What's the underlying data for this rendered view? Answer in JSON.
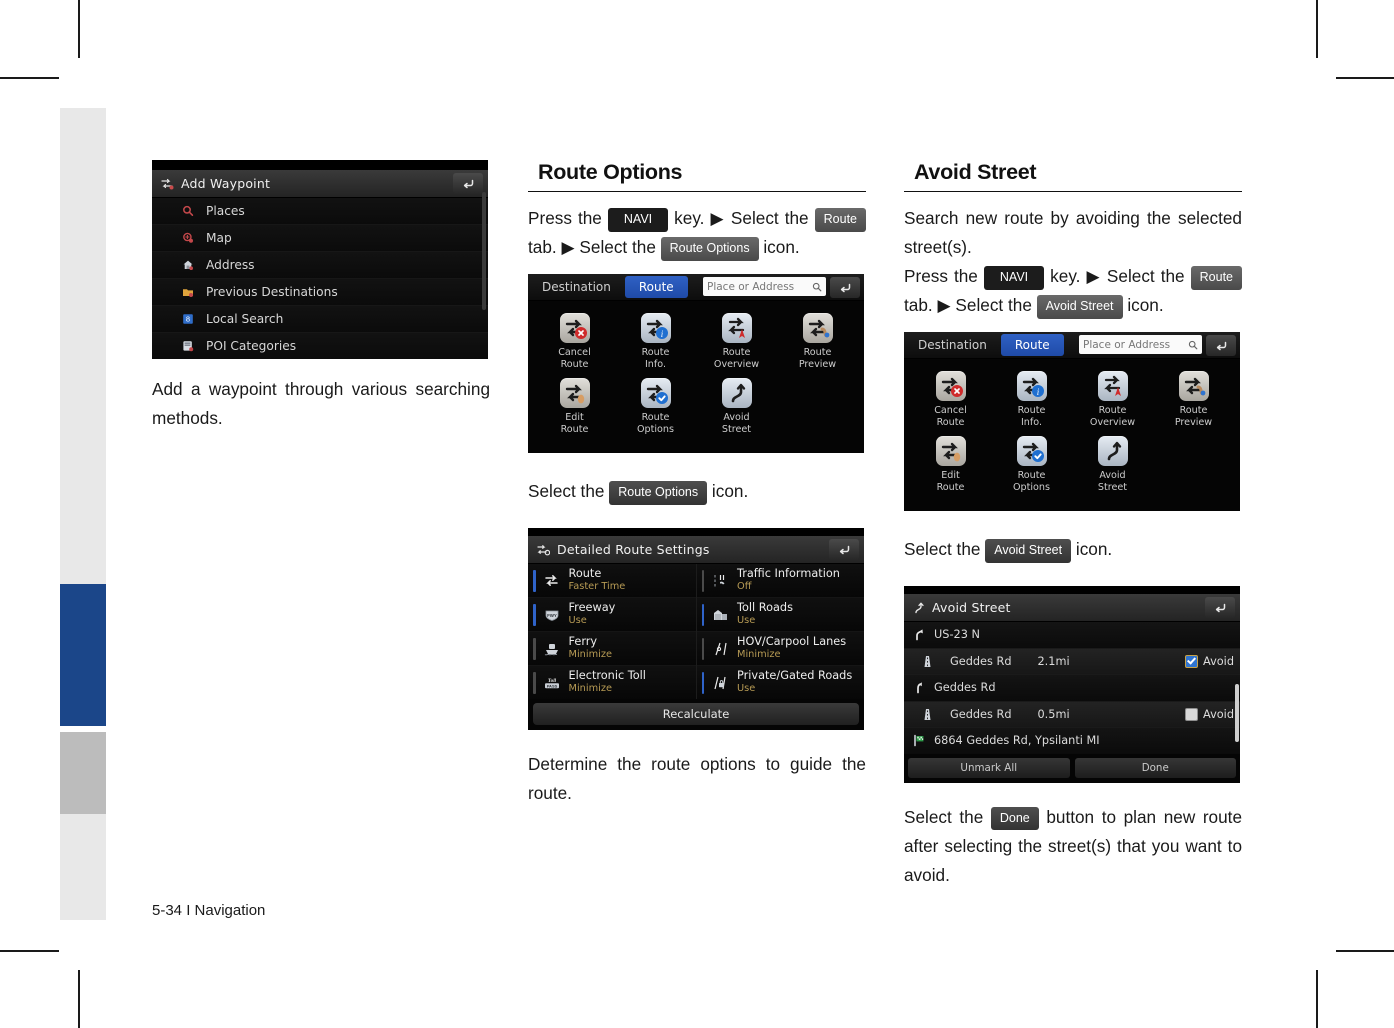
{
  "page": {
    "footer": "5-34 I Navigation"
  },
  "sidebar": {
    "segments": [
      {
        "name": "tab-light-top",
        "color": "#e8e8e8"
      },
      {
        "name": "tab-active-blue",
        "color": "#1b4689"
      },
      {
        "name": "tab-gray",
        "color": "#bcbcbc"
      },
      {
        "name": "tab-light-bottom",
        "color": "#e8e8e8"
      }
    ]
  },
  "left_column": {
    "screenshot": {
      "title": "Add Waypoint",
      "title_icon": "waypoint-icon",
      "back_icon": "back-arrow-icon",
      "items": [
        {
          "label": "Places",
          "icon": "magnifier-icon"
        },
        {
          "label": "Map",
          "icon": "map-pin-icon"
        },
        {
          "label": "Address",
          "icon": "home-icon"
        },
        {
          "label": "Previous Destinations",
          "icon": "folder-icon"
        },
        {
          "label": "Local Search",
          "icon": "local-search-icon"
        },
        {
          "label": "POI Categories",
          "icon": "poi-icon"
        }
      ]
    },
    "caption": "Add a waypoint through various searching methods."
  },
  "middle_column": {
    "heading": "Route Options",
    "instruction": {
      "press_the": "Press the",
      "navi_key": "NAVI",
      "key_select_the": "key. ▶ Select the",
      "route_tab": "Route",
      "tab_select_the": "tab. ▶ Select the",
      "target_chip": "Route Options",
      "icon_word": "icon."
    },
    "screenshot": {
      "tabs": [
        {
          "label": "Destination",
          "active": false
        },
        {
          "label": "Route",
          "active": true
        }
      ],
      "search_placeholder": "Place or Address",
      "search_icon": "magnifier-icon",
      "back_icon": "back-arrow-icon",
      "icons": [
        {
          "line1": "Cancel",
          "line2": "Route",
          "name": "cancel-route-icon",
          "tile": "#c9c6c0"
        },
        {
          "line1": "Route",
          "line2": "Info.",
          "name": "route-info-icon",
          "tile": "#cfd6de"
        },
        {
          "line1": "Route",
          "line2": "Overview",
          "name": "route-overview-icon",
          "tile": "#cfd6de"
        },
        {
          "line1": "Route",
          "line2": "Preview",
          "name": "route-preview-icon",
          "tile": "#c9c6c0"
        },
        {
          "line1": "Edit",
          "line2": "Route",
          "name": "edit-route-icon",
          "tile": "#c9c6c0"
        },
        {
          "line1": "Route",
          "line2": "Options",
          "name": "route-options-icon",
          "tile": "#cfd6de"
        },
        {
          "line1": "Avoid",
          "line2": "Street",
          "name": "avoid-street-icon",
          "tile": "#cfd6de"
        }
      ]
    },
    "select_line": {
      "select_the": "Select the",
      "chip": "Route Options",
      "icon_word": "icon."
    },
    "settings_screenshot": {
      "title": "Detailed Route Settings",
      "title_icon": "route-settings-icon",
      "back_icon": "back-arrow-icon",
      "left_items": [
        {
          "label": "Route",
          "value": "Faster Time",
          "icon": "route-icon",
          "bar": "#2f63c9"
        },
        {
          "label": "Freeway",
          "value": "Use",
          "icon": "freeway-shield-icon",
          "bar": "#2f63c9"
        },
        {
          "label": "Ferry",
          "value": "Minimize",
          "icon": "ferry-icon",
          "bar": "#4a4a4a"
        },
        {
          "label": "Electronic Toll",
          "value": "Minimize",
          "icon": "toll-pass-icon",
          "bar": "#4a4a4a"
        }
      ],
      "right_items": [
        {
          "label": "Traffic Information",
          "value": "Off",
          "icon": "traffic-icon",
          "bar": "#4a4a4a"
        },
        {
          "label": "Toll Roads",
          "value": "Use",
          "icon": "toll-booth-icon",
          "bar": "#2f63c9"
        },
        {
          "label": "HOV/Carpool Lanes",
          "value": "Minimize",
          "icon": "hov-lane-icon",
          "bar": "#4a4a4a"
        },
        {
          "label": "Private/Gated Roads",
          "value": "Use",
          "icon": "gated-road-icon",
          "bar": "#2f63c9"
        }
      ],
      "recalculate": "Recalculate"
    },
    "caption": "Determine the route options to guide the route."
  },
  "right_column": {
    "heading": "Avoid Street",
    "description": "Search new route by avoiding the selected street(s).",
    "instruction": {
      "press_the": "Press the",
      "navi_key": "NAVI",
      "key_select_the": "key. ▶ Select the",
      "route_tab": "Route",
      "tab_select_the": "tab. ▶ Select the",
      "target_chip": "Avoid Street",
      "icon_word": "icon."
    },
    "screenshot": {
      "tabs": [
        {
          "label": "Destination",
          "active": false
        },
        {
          "label": "Route",
          "active": true
        }
      ],
      "search_placeholder": "Place or Address",
      "search_icon": "magnifier-icon",
      "back_icon": "back-arrow-icon",
      "icons": [
        {
          "line1": "Cancel",
          "line2": "Route",
          "name": "cancel-route-icon",
          "tile": "#c9c6c0"
        },
        {
          "line1": "Route",
          "line2": "Info.",
          "name": "route-info-icon",
          "tile": "#cfd6de"
        },
        {
          "line1": "Route",
          "line2": "Overview",
          "name": "route-overview-icon",
          "tile": "#cfd6de"
        },
        {
          "line1": "Route",
          "line2": "Preview",
          "name": "route-preview-icon",
          "tile": "#c9c6c0"
        },
        {
          "line1": "Edit",
          "line2": "Route",
          "name": "edit-route-icon",
          "tile": "#c9c6c0"
        },
        {
          "line1": "Route",
          "line2": "Options",
          "name": "route-options-icon",
          "tile": "#cfd6de"
        },
        {
          "line1": "Avoid",
          "line2": "Street",
          "name": "avoid-street-icon",
          "tile": "#cfd6de"
        }
      ]
    },
    "select_line": {
      "select_the": "Select the",
      "chip": "Avoid Street",
      "icon_word": "icon."
    },
    "avoid_screenshot": {
      "title": "Avoid Street",
      "title_icon": "avoid-street-icon",
      "back_icon": "back-arrow-icon",
      "rows": [
        {
          "icon": "turn-right-icon",
          "name": "US-23 N",
          "distance": "",
          "checkbox": null,
          "check_label": "",
          "indent": false,
          "shade": false
        },
        {
          "icon": "road-icon",
          "name": "Geddes Rd",
          "distance": "2.1mi",
          "checkbox": true,
          "check_label": "Avoid",
          "indent": true,
          "shade": true
        },
        {
          "icon": "turn-slight-icon",
          "name": "Geddes Rd",
          "distance": "",
          "checkbox": null,
          "check_label": "",
          "indent": false,
          "shade": false
        },
        {
          "icon": "road-icon",
          "name": "Geddes Rd",
          "distance": "0.5mi",
          "checkbox": false,
          "check_label": "Avoid",
          "indent": true,
          "shade": true
        },
        {
          "icon": "flag-icon",
          "name": "6864 Geddes Rd, Ypsilanti MI",
          "distance": "",
          "checkbox": null,
          "check_label": "",
          "indent": false,
          "shade": false
        }
      ],
      "buttons": [
        {
          "label": "Unmark All",
          "name": "unmark-all-button"
        },
        {
          "label": "Done",
          "name": "done-button"
        }
      ]
    },
    "caption": {
      "select_the": "Select the",
      "chip": "Done",
      "rest": "button to plan new route after selecting the street(s) that you want to avoid."
    }
  }
}
